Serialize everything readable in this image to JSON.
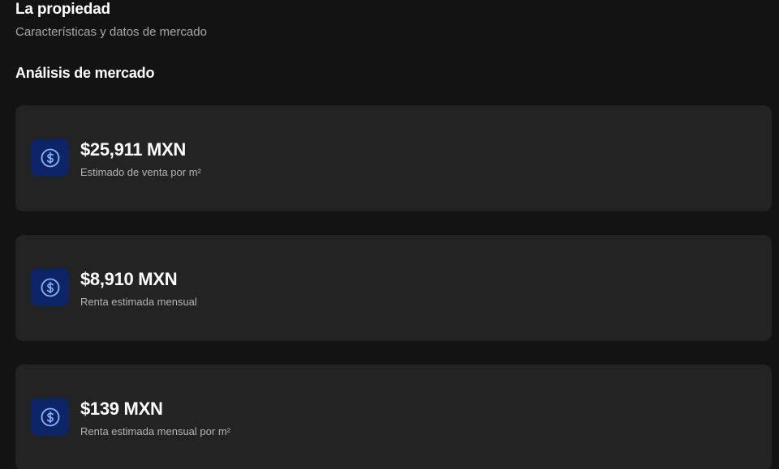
{
  "header": {
    "title": "La propiedad",
    "subtitle": "Características y datos de mercado"
  },
  "market": {
    "title": "Análisis de mercado",
    "cards": [
      {
        "value": "$25,911 MXN",
        "label": "Estimado de venta por m²",
        "icon": "dollar-circle-icon"
      },
      {
        "value": "$8,910 MXN",
        "label": "Renta estimada mensual",
        "icon": "dollar-circle-icon"
      },
      {
        "value": "$139 MXN",
        "label": "Renta estimada mensual por m²",
        "icon": "dollar-circle-icon"
      }
    ]
  },
  "colors": {
    "background": "#131313",
    "card": "#232323",
    "icon_bg": "#0d2566",
    "icon_fg": "#8ab4ff"
  }
}
